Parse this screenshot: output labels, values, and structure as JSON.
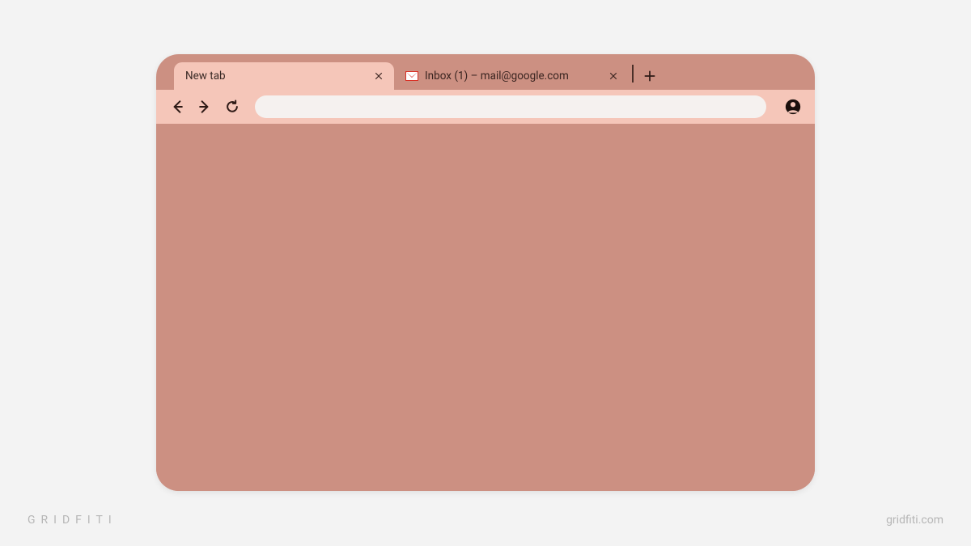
{
  "tabs": [
    {
      "title": "New tab",
      "active": true
    },
    {
      "title": "Inbox (1) – mail@google.com",
      "active": false,
      "icon": "gmail"
    }
  ],
  "toolbar": {
    "address_value": ""
  },
  "watermark": {
    "left": "GRIDFITI",
    "right": "gridfiti.com"
  },
  "colors": {
    "frame": "#cc9082",
    "toolbar": "#f5c6b9",
    "page_bg": "#f3f3f3"
  }
}
